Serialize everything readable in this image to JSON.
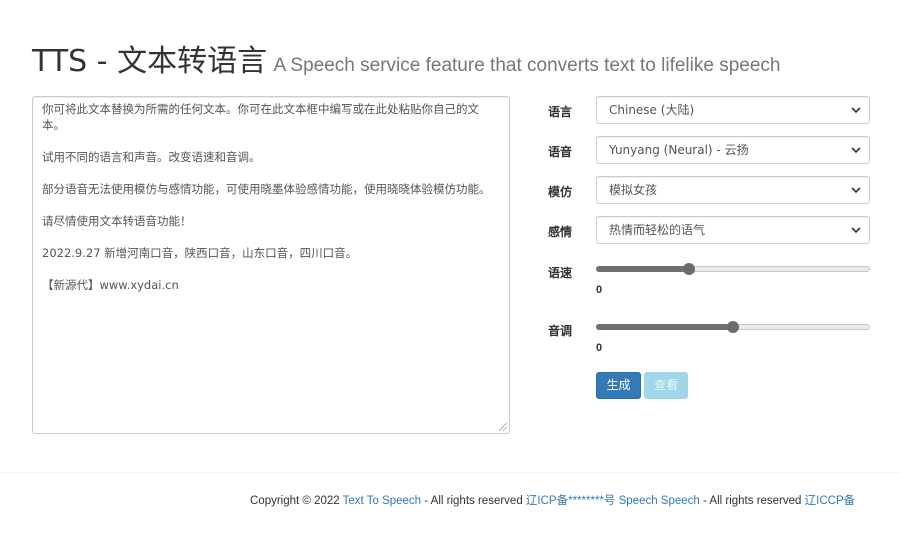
{
  "header": {
    "title": "TTS - 文本转语言",
    "subtitle": "A Speech service feature that converts text to lifelike speech"
  },
  "text_input": {
    "paragraphs": [
      "你可将此文本替换为所需的任何文本。你可在此文本框中编写或在此处粘贴你自己的文本。",
      "试用不同的语言和声音。改变语速和音调。",
      "部分语音无法使用模仿与感情功能，可使用晓墨体验感情功能，使用晓晓体验模仿功能。",
      "请尽情使用文本转语音功能！",
      "2022.9.27 新增河南口音，陕西口音，山东口音，四川口音。",
      "【新源代】www.xydai.cn"
    ]
  },
  "form": {
    "language": {
      "label": "语言",
      "value": "Chinese (大陆)"
    },
    "voice": {
      "label": "语音",
      "value": "Yunyang (Neural) - 云扬"
    },
    "imitation": {
      "label": "模仿",
      "value": "模拟女孩"
    },
    "emotion": {
      "label": "感情",
      "value": "热情而轻松的语气"
    },
    "rate": {
      "label": "语速",
      "value": "0",
      "level": 0.34
    },
    "pitch": {
      "label": "音调",
      "value": "0",
      "level": 0.5
    }
  },
  "buttons": {
    "generate": "生成",
    "view": "查看"
  },
  "footer": {
    "copyright_prefix": "Copyright © 2022 ",
    "link1": "Text To Speech",
    "rights1": " - All rights reserved ",
    "link2": "辽ICP备********号",
    "space": " ",
    "link3": "Speech Speech",
    "rights2": " - All rights reserved ",
    "link4": "辽ICCP备"
  },
  "colors": {
    "primary": "#337ab7",
    "info": "#9fd6ea",
    "link": "#337ab7"
  }
}
